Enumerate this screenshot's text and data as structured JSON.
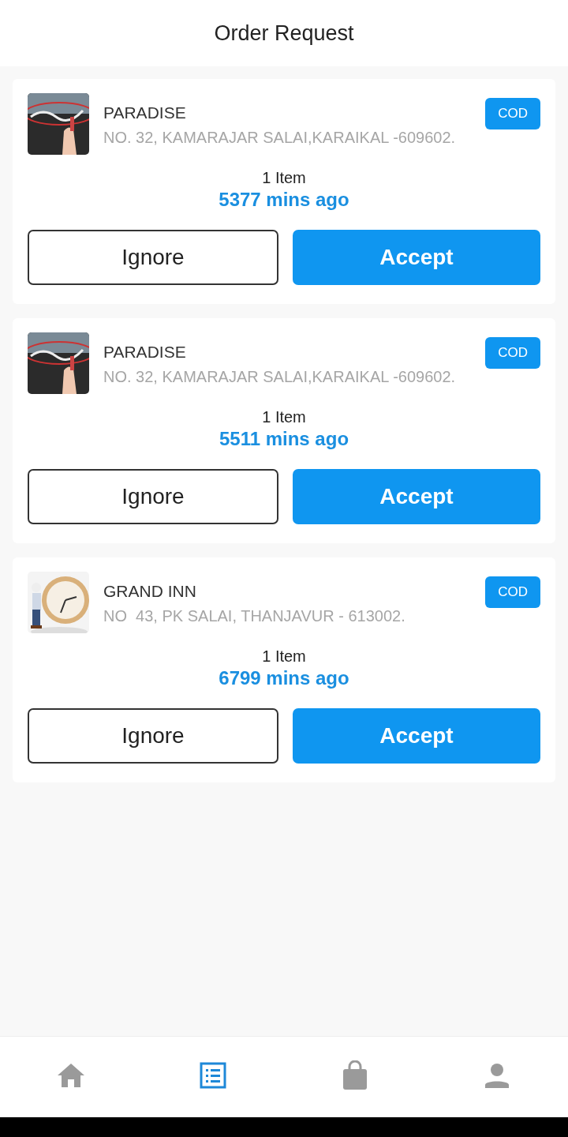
{
  "header": {
    "title": "Order Request"
  },
  "orders": [
    {
      "name": "PARADISE",
      "address": "NO. 32, KAMARAJAR SALAI,KARAIKAL -609602.",
      "payment": "COD",
      "items": "1 Item",
      "time": "5377 mins ago",
      "ignore": "Ignore",
      "accept": "Accept"
    },
    {
      "name": "PARADISE",
      "address": "NO. 32, KAMARAJAR SALAI,KARAIKAL -609602.",
      "payment": "COD",
      "items": "1 Item",
      "time": "5511 mins ago",
      "ignore": "Ignore",
      "accept": "Accept"
    },
    {
      "name": "GRAND INN",
      "address": "NO  43, PK SALAI, THANJAVUR - 613002.",
      "payment": "COD",
      "items": "1 Item",
      "time": "6799 mins ago",
      "ignore": "Ignore",
      "accept": "Accept"
    }
  ],
  "nav": [
    {
      "kind": "home",
      "selected": false
    },
    {
      "kind": "list",
      "selected": true
    },
    {
      "kind": "bag",
      "selected": false
    },
    {
      "kind": "person",
      "selected": false
    }
  ]
}
